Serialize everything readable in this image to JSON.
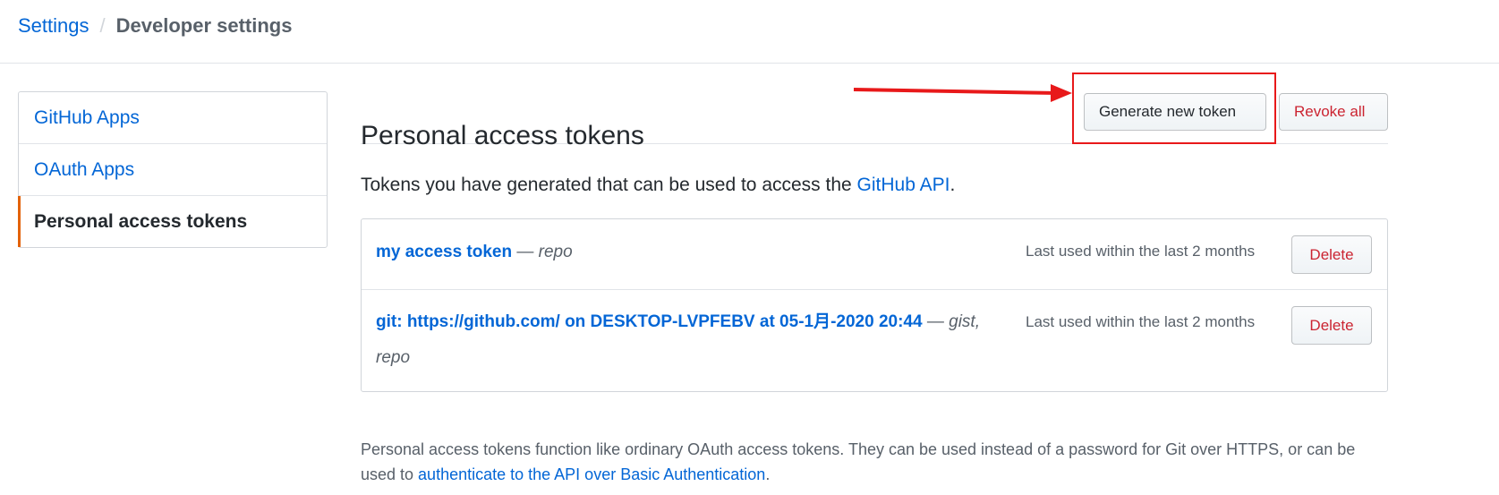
{
  "breadcrumb": {
    "settings": "Settings",
    "separator": "/",
    "current": "Developer settings"
  },
  "sidebar": {
    "items": [
      {
        "label": "GitHub Apps",
        "selected": false
      },
      {
        "label": "OAuth Apps",
        "selected": false
      },
      {
        "label": "Personal access tokens",
        "selected": true
      }
    ],
    "selected_accent": "#e36209"
  },
  "main": {
    "title": "Personal access tokens",
    "generate_button": "Generate new token",
    "revoke_all_button": "Revoke all",
    "description_prefix": "Tokens you have generated that can be used to access the ",
    "description_link": "GitHub API",
    "description_suffix": ".",
    "tokens": [
      {
        "name": "my access token",
        "dash": " — ",
        "scopes": "repo",
        "last_used": "Last used within the last 2 months",
        "delete_label": "Delete"
      },
      {
        "name": "git: https://github.com/ on DESKTOP-LVPFEBV at 05-1月-2020 20:44",
        "dash": " — ",
        "scopes": "gist, repo",
        "last_used": "Last used within the last 2 months",
        "delete_label": "Delete"
      }
    ],
    "footnote_prefix": "Personal access tokens function like ordinary OAuth access tokens. They can be used instead of a password for Git over HTTPS, or can be used to ",
    "footnote_link": "authenticate to the API over Basic Authentication",
    "footnote_suffix": "."
  },
  "annotation": {
    "color": "#e8191a",
    "arrow_icon": "red-arrow-icon"
  },
  "colors": {
    "link": "#0366d6",
    "danger": "#cb2431",
    "muted": "#586069"
  }
}
